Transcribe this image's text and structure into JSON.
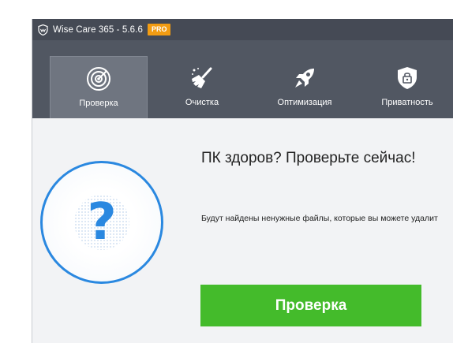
{
  "titlebar": {
    "app_name": "Wise Care 365 - 5.6.6",
    "badge": "PRO",
    "logo_icon": "shield-logo-icon"
  },
  "toolbar": {
    "tabs": [
      {
        "label": "Проверка",
        "icon": "radar-icon",
        "active": true
      },
      {
        "label": "Очистка",
        "icon": "broom-icon",
        "active": false
      },
      {
        "label": "Оптимизация",
        "icon": "rocket-icon",
        "active": false
      },
      {
        "label": "Приватность",
        "icon": "shield-lock-icon",
        "active": false
      }
    ]
  },
  "main": {
    "headline": "ПК здоров? Проверьте сейчас!",
    "description": "Будут найдены ненужные файлы, которые вы можете удалит",
    "status_symbol": "?",
    "scan_button_label": "Проверка"
  },
  "colors": {
    "titlebar_bg": "#454a55",
    "toolbar_bg": "#515762",
    "accent_blue": "#2a88e0",
    "button_green": "#44bb2b",
    "badge_orange": "#f39c12"
  }
}
